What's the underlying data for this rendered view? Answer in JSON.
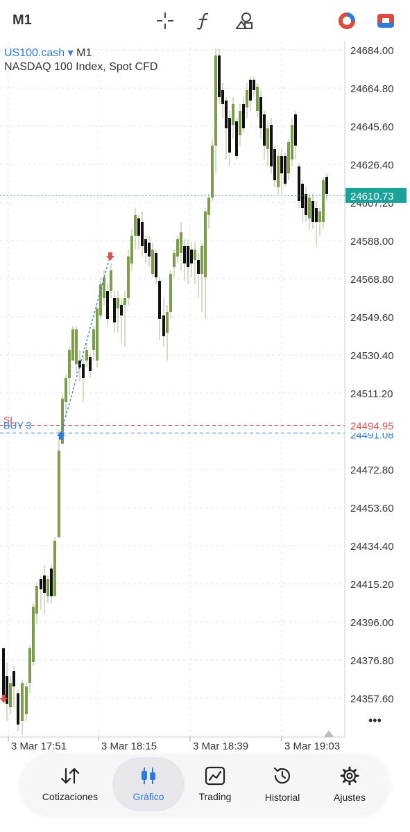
{
  "toolbar": {
    "timeframe": "M1",
    "icons": [
      "crosshair-icon",
      "function-icon",
      "objects-icon",
      "account-colors-icon",
      "trade-icon"
    ]
  },
  "symbol": {
    "name": "US100.cash",
    "dropdown_glyph": "▾",
    "timeframe": "M1",
    "description": "NASDAQ 100 Index, Spot CFD"
  },
  "price_axis": {
    "ticks": [
      "24684.00",
      "24664.80",
      "24645.60",
      "24626.40",
      "24607.20",
      "24588.00",
      "24568.80",
      "24549.60",
      "24530.40",
      "24511.20",
      "24494.95",
      "24491.08",
      "24472.80",
      "24453.60",
      "24434.40",
      "24415.20",
      "24396.00",
      "24376.80",
      "24357.60"
    ],
    "current_price": "24610.73",
    "sl_price": "24494.95",
    "buy_price": "24491.08",
    "more": "•••"
  },
  "time_axis": {
    "ticks": [
      "3 Mar 17:51",
      "3 Mar 18:15",
      "3 Mar 18:39",
      "3 Mar 19:03"
    ]
  },
  "order_lines": {
    "sl_label": "SL",
    "buy_label": "BUY 3"
  },
  "colors": {
    "bull": "#7a9e4a",
    "bear": "#111111",
    "accent": "#2f7bd8",
    "sl": "#d9534f",
    "current": "#1aa39a"
  },
  "nav": {
    "items": [
      {
        "label": "Cotizaciones",
        "icon": "quotes-icon"
      },
      {
        "label": "Gráfico",
        "icon": "chart-icon",
        "active": true
      },
      {
        "label": "Trading",
        "icon": "trading-icon"
      },
      {
        "label": "Historial",
        "icon": "history-icon"
      },
      {
        "label": "Ajustes",
        "icon": "settings-icon"
      }
    ]
  }
}
